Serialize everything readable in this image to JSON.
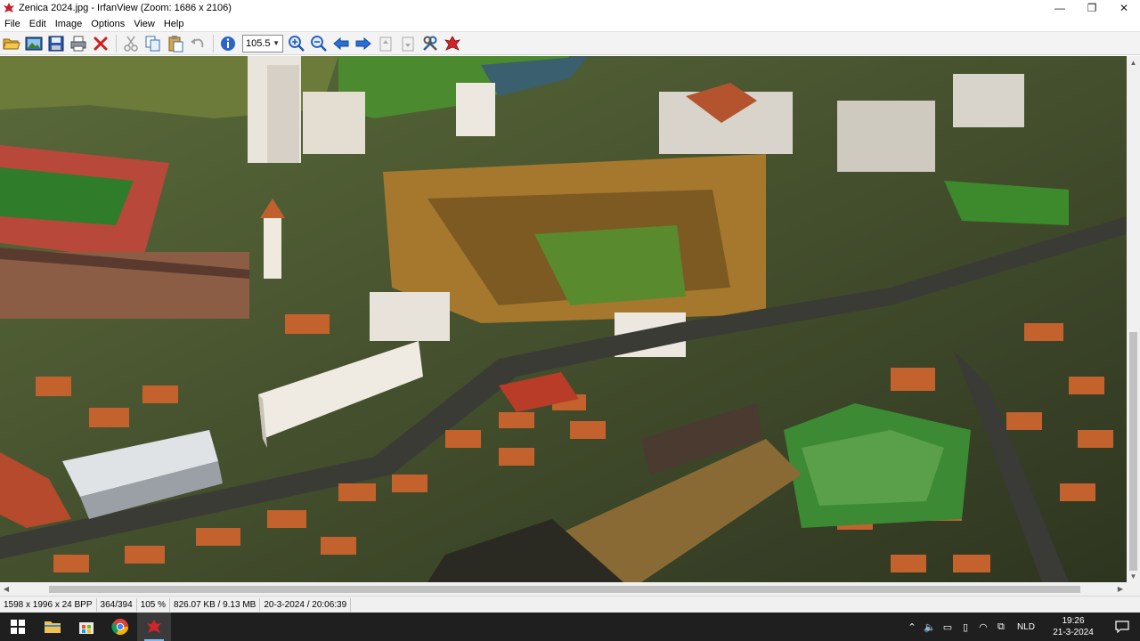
{
  "window": {
    "title": "Zenica 2024.jpg - IrfanView (Zoom: 1686 x 2106)",
    "minimize_glyph": "—",
    "maximize_glyph": "❐",
    "close_glyph": "✕"
  },
  "menu": {
    "items": [
      "File",
      "Edit",
      "Image",
      "Options",
      "View",
      "Help"
    ]
  },
  "toolbar": {
    "zoom_value": "105.5",
    "buttons": [
      {
        "name": "open-folder-icon",
        "enabled": true
      },
      {
        "name": "thumbnails-icon",
        "enabled": true
      },
      {
        "name": "save-icon",
        "enabled": true
      },
      {
        "name": "print-icon",
        "enabled": true
      },
      {
        "name": "delete-icon",
        "enabled": true
      },
      {
        "name": "cut-icon",
        "enabled": false
      },
      {
        "name": "copy-icon",
        "enabled": true
      },
      {
        "name": "paste-icon",
        "enabled": true
      },
      {
        "name": "undo-icon",
        "enabled": false
      },
      {
        "name": "info-icon",
        "enabled": true
      },
      {
        "name": "zoom-in-icon",
        "enabled": true
      },
      {
        "name": "zoom-out-icon",
        "enabled": true
      },
      {
        "name": "previous-icon",
        "enabled": true
      },
      {
        "name": "next-icon",
        "enabled": true
      },
      {
        "name": "page-prev-icon",
        "enabled": false
      },
      {
        "name": "page-next-icon",
        "enabled": false
      },
      {
        "name": "settings-icon",
        "enabled": true
      },
      {
        "name": "irfanview-icon",
        "enabled": true
      }
    ]
  },
  "image": {
    "subject": "aerial city photo"
  },
  "statusbar": {
    "dimensions": "1598 x 1996 x 24 BPP",
    "index": "364/394",
    "zoom": "105 %",
    "size": "826.07 KB / 9.13 MB",
    "datetime": "20-3-2024 / 20:06:39"
  },
  "taskbar": {
    "apps": [
      {
        "name": "file-explorer-icon",
        "active": false
      },
      {
        "name": "store-icon",
        "active": false
      },
      {
        "name": "chrome-icon",
        "active": false
      },
      {
        "name": "irfanview-taskbar-icon",
        "active": true
      }
    ],
    "tray": {
      "language": "NLD",
      "time": "19:26",
      "date": "21-3-2024"
    }
  },
  "colors": {
    "toolbar_bg": "#f3f3f3",
    "taskbar_bg": "#1f1f1f",
    "statusbar_bg": "#f0f0f0"
  }
}
